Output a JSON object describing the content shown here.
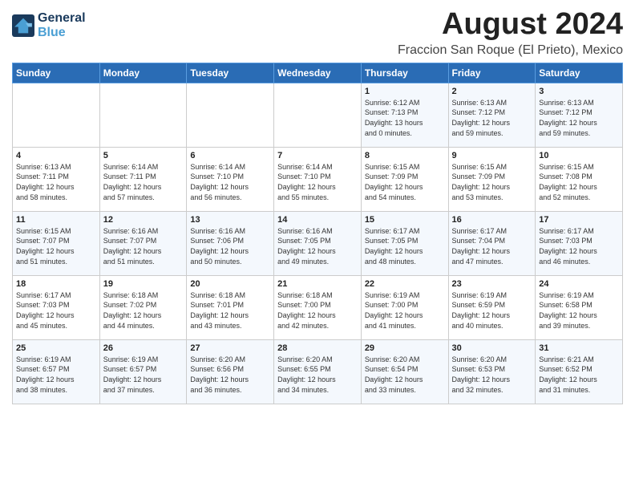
{
  "header": {
    "logo_line1": "General",
    "logo_line2": "Blue",
    "month_year": "August 2024",
    "location": "Fraccion San Roque (El Prieto), Mexico"
  },
  "weekdays": [
    "Sunday",
    "Monday",
    "Tuesday",
    "Wednesday",
    "Thursday",
    "Friday",
    "Saturday"
  ],
  "weeks": [
    [
      {
        "day": "",
        "info": ""
      },
      {
        "day": "",
        "info": ""
      },
      {
        "day": "",
        "info": ""
      },
      {
        "day": "",
        "info": ""
      },
      {
        "day": "1",
        "info": "Sunrise: 6:12 AM\nSunset: 7:13 PM\nDaylight: 13 hours\nand 0 minutes."
      },
      {
        "day": "2",
        "info": "Sunrise: 6:13 AM\nSunset: 7:12 PM\nDaylight: 12 hours\nand 59 minutes."
      },
      {
        "day": "3",
        "info": "Sunrise: 6:13 AM\nSunset: 7:12 PM\nDaylight: 12 hours\nand 59 minutes."
      }
    ],
    [
      {
        "day": "4",
        "info": "Sunrise: 6:13 AM\nSunset: 7:11 PM\nDaylight: 12 hours\nand 58 minutes."
      },
      {
        "day": "5",
        "info": "Sunrise: 6:14 AM\nSunset: 7:11 PM\nDaylight: 12 hours\nand 57 minutes."
      },
      {
        "day": "6",
        "info": "Sunrise: 6:14 AM\nSunset: 7:10 PM\nDaylight: 12 hours\nand 56 minutes."
      },
      {
        "day": "7",
        "info": "Sunrise: 6:14 AM\nSunset: 7:10 PM\nDaylight: 12 hours\nand 55 minutes."
      },
      {
        "day": "8",
        "info": "Sunrise: 6:15 AM\nSunset: 7:09 PM\nDaylight: 12 hours\nand 54 minutes."
      },
      {
        "day": "9",
        "info": "Sunrise: 6:15 AM\nSunset: 7:09 PM\nDaylight: 12 hours\nand 53 minutes."
      },
      {
        "day": "10",
        "info": "Sunrise: 6:15 AM\nSunset: 7:08 PM\nDaylight: 12 hours\nand 52 minutes."
      }
    ],
    [
      {
        "day": "11",
        "info": "Sunrise: 6:15 AM\nSunset: 7:07 PM\nDaylight: 12 hours\nand 51 minutes."
      },
      {
        "day": "12",
        "info": "Sunrise: 6:16 AM\nSunset: 7:07 PM\nDaylight: 12 hours\nand 51 minutes."
      },
      {
        "day": "13",
        "info": "Sunrise: 6:16 AM\nSunset: 7:06 PM\nDaylight: 12 hours\nand 50 minutes."
      },
      {
        "day": "14",
        "info": "Sunrise: 6:16 AM\nSunset: 7:05 PM\nDaylight: 12 hours\nand 49 minutes."
      },
      {
        "day": "15",
        "info": "Sunrise: 6:17 AM\nSunset: 7:05 PM\nDaylight: 12 hours\nand 48 minutes."
      },
      {
        "day": "16",
        "info": "Sunrise: 6:17 AM\nSunset: 7:04 PM\nDaylight: 12 hours\nand 47 minutes."
      },
      {
        "day": "17",
        "info": "Sunrise: 6:17 AM\nSunset: 7:03 PM\nDaylight: 12 hours\nand 46 minutes."
      }
    ],
    [
      {
        "day": "18",
        "info": "Sunrise: 6:17 AM\nSunset: 7:03 PM\nDaylight: 12 hours\nand 45 minutes."
      },
      {
        "day": "19",
        "info": "Sunrise: 6:18 AM\nSunset: 7:02 PM\nDaylight: 12 hours\nand 44 minutes."
      },
      {
        "day": "20",
        "info": "Sunrise: 6:18 AM\nSunset: 7:01 PM\nDaylight: 12 hours\nand 43 minutes."
      },
      {
        "day": "21",
        "info": "Sunrise: 6:18 AM\nSunset: 7:00 PM\nDaylight: 12 hours\nand 42 minutes."
      },
      {
        "day": "22",
        "info": "Sunrise: 6:19 AM\nSunset: 7:00 PM\nDaylight: 12 hours\nand 41 minutes."
      },
      {
        "day": "23",
        "info": "Sunrise: 6:19 AM\nSunset: 6:59 PM\nDaylight: 12 hours\nand 40 minutes."
      },
      {
        "day": "24",
        "info": "Sunrise: 6:19 AM\nSunset: 6:58 PM\nDaylight: 12 hours\nand 39 minutes."
      }
    ],
    [
      {
        "day": "25",
        "info": "Sunrise: 6:19 AM\nSunset: 6:57 PM\nDaylight: 12 hours\nand 38 minutes."
      },
      {
        "day": "26",
        "info": "Sunrise: 6:19 AM\nSunset: 6:57 PM\nDaylight: 12 hours\nand 37 minutes."
      },
      {
        "day": "27",
        "info": "Sunrise: 6:20 AM\nSunset: 6:56 PM\nDaylight: 12 hours\nand 36 minutes."
      },
      {
        "day": "28",
        "info": "Sunrise: 6:20 AM\nSunset: 6:55 PM\nDaylight: 12 hours\nand 34 minutes."
      },
      {
        "day": "29",
        "info": "Sunrise: 6:20 AM\nSunset: 6:54 PM\nDaylight: 12 hours\nand 33 minutes."
      },
      {
        "day": "30",
        "info": "Sunrise: 6:20 AM\nSunset: 6:53 PM\nDaylight: 12 hours\nand 32 minutes."
      },
      {
        "day": "31",
        "info": "Sunrise: 6:21 AM\nSunset: 6:52 PM\nDaylight: 12 hours\nand 31 minutes."
      }
    ]
  ]
}
